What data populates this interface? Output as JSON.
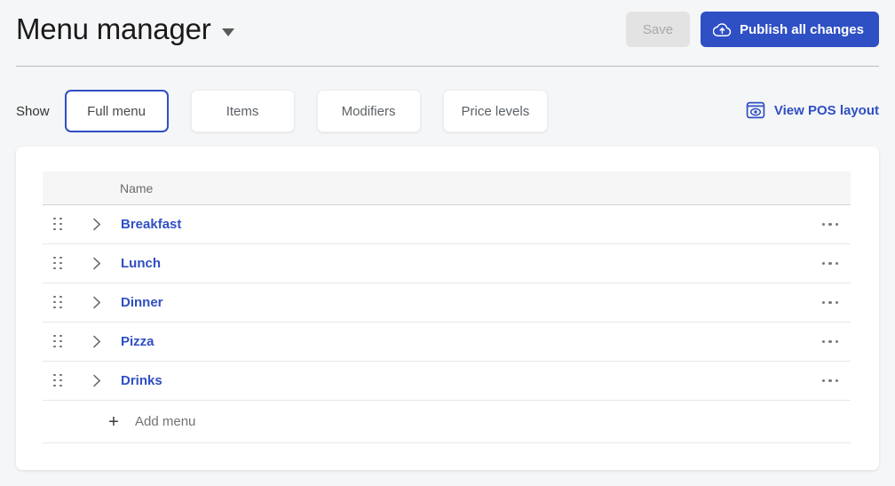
{
  "header": {
    "title": "Menu manager",
    "title_dropdown_icon": "caret-down-icon",
    "save_label": "Save",
    "publish_label": "Publish all changes",
    "publish_icon": "cloud-upload-icon",
    "accent_color": "#2f4fc4",
    "save_bg_color": "#e3e3e3",
    "save_text_color": "#a8a8a8"
  },
  "filters": {
    "show_label": "Show",
    "tabs": [
      {
        "label": "Full menu",
        "selected": true
      },
      {
        "label": "Items",
        "selected": false
      },
      {
        "label": "Modifiers",
        "selected": false
      },
      {
        "label": "Price levels",
        "selected": false
      }
    ],
    "pos_link": {
      "label": "View POS layout",
      "icon": "pos-eye-icon",
      "color": "#2f4fc4"
    }
  },
  "table": {
    "columns": [
      "",
      "",
      "Name"
    ],
    "name_header": "Name",
    "rows": [
      {
        "name": "Breakfast",
        "drag_icon": "drag-handle-icon",
        "expand_icon": "chevron-right-icon",
        "more_icon": "ellipsis-icon"
      },
      {
        "name": "Lunch",
        "drag_icon": "drag-handle-icon",
        "expand_icon": "chevron-right-icon",
        "more_icon": "ellipsis-icon"
      },
      {
        "name": "Dinner",
        "drag_icon": "drag-handle-icon",
        "expand_icon": "chevron-right-icon",
        "more_icon": "ellipsis-icon"
      },
      {
        "name": "Pizza",
        "drag_icon": "drag-handle-icon",
        "expand_icon": "chevron-right-icon",
        "more_icon": "ellipsis-icon"
      },
      {
        "name": "Drinks",
        "drag_icon": "drag-handle-icon",
        "expand_icon": "chevron-right-icon",
        "more_icon": "ellipsis-icon"
      }
    ],
    "add_row": {
      "label": "Add menu",
      "icon": "plus-icon",
      "symbol": "+"
    }
  }
}
